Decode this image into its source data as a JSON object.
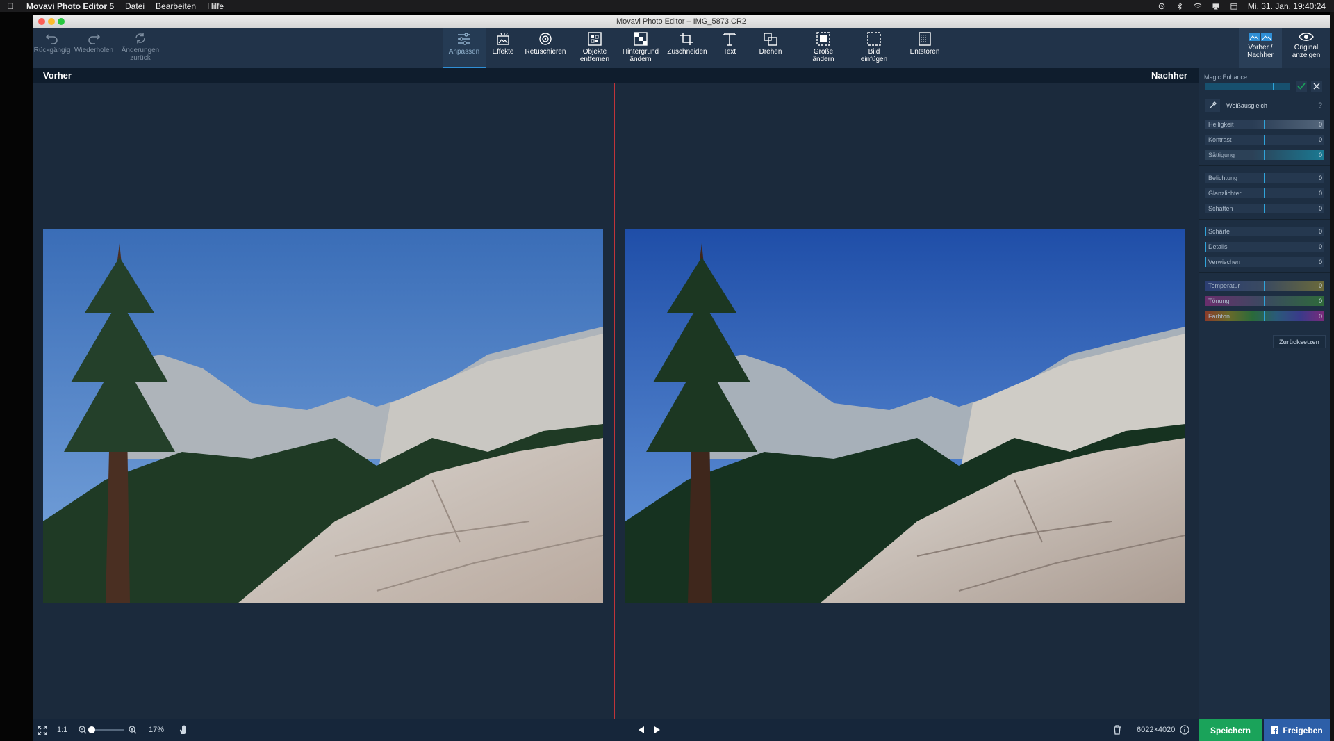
{
  "menubar": {
    "app_name": "Movavi Photo Editor 5",
    "menus": [
      "Datei",
      "Bearbeiten",
      "Hilfe"
    ],
    "clock": "Mi. 31. Jan.  19:40:24"
  },
  "window": {
    "title": "Movavi Photo Editor – IMG_5873.CR2"
  },
  "toolbar": {
    "undo": "Rückgängig",
    "redo": "Wiederholen",
    "revert_line1": "Änderungen",
    "revert_line2": "zurück",
    "tools": [
      {
        "l1": "Anpassen",
        "l2": ""
      },
      {
        "l1": "Effekte",
        "l2": ""
      },
      {
        "l1": "Retuschieren",
        "l2": ""
      },
      {
        "l1": "Objekte",
        "l2": "entfernen"
      },
      {
        "l1": "Hintergrund",
        "l2": "ändern"
      },
      {
        "l1": "Zuschneiden",
        "l2": ""
      },
      {
        "l1": "Text",
        "l2": ""
      },
      {
        "l1": "Drehen",
        "l2": ""
      },
      {
        "l1": "Größe",
        "l2": "ändern"
      },
      {
        "l1": "Bild",
        "l2": "einfügen"
      },
      {
        "l1": "Entstören",
        "l2": ""
      }
    ],
    "before_after_l1": "Vorher /",
    "before_after_l2": "Nachher",
    "show_original_l1": "Original",
    "show_original_l2": "anzeigen"
  },
  "view": {
    "before_label": "Vorher",
    "after_label": "Nachher"
  },
  "panel": {
    "magic_enhance": "Magic Enhance",
    "white_balance": "Weißausgleich",
    "help": "?",
    "sliders": [
      {
        "label": "Helligkeit",
        "value": "0"
      },
      {
        "label": "Kontrast",
        "value": "0"
      },
      {
        "label": "Sättigung",
        "value": "0"
      },
      {
        "label": "Belichtung",
        "value": "0"
      },
      {
        "label": "Glanzlichter",
        "value": "0"
      },
      {
        "label": "Schatten",
        "value": "0"
      },
      {
        "label": "Schärfe",
        "value": "0"
      },
      {
        "label": "Details",
        "value": "0"
      },
      {
        "label": "Verwischen",
        "value": "0"
      },
      {
        "label": "Temperatur",
        "value": "0"
      },
      {
        "label": "Tönung",
        "value": "0"
      },
      {
        "label": "Farbton",
        "value": "0"
      }
    ],
    "reset": "Zurücksetzen"
  },
  "statusbar": {
    "one_to_one": "1:1",
    "zoom": "17%",
    "dimensions": "6022×4020",
    "save": "Speichern",
    "share": "Freigeben"
  },
  "colors": {
    "accent": "#2f8fd6",
    "save": "#1aa35a",
    "share": "#2d5fa8",
    "divider": "#c0343a"
  }
}
